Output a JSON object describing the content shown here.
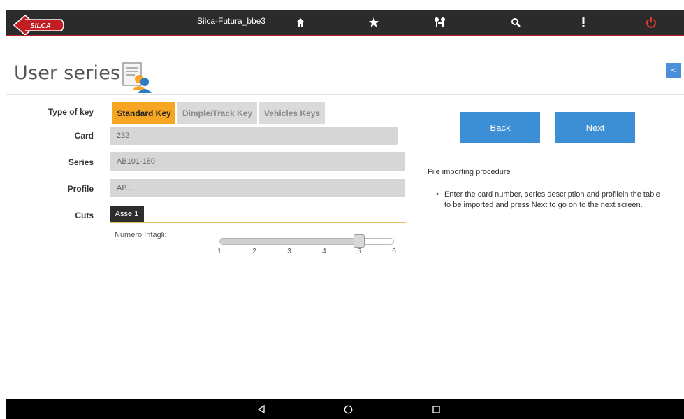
{
  "topbar": {
    "title": "Silca-Futura_bbe3",
    "logo_text": "SILCA",
    "icons": [
      "home-icon",
      "star-icon",
      "keys-icon",
      "search-icon",
      "info-icon",
      "power-icon"
    ],
    "accent_color": "#c31d24",
    "power_color": "#e23b2e"
  },
  "header": {
    "title": "User series",
    "title_icon": "user-document-icon",
    "collapse_label": "<"
  },
  "form": {
    "type_of_key_label": "Type of key",
    "tabs": [
      {
        "label": "Standard Key",
        "active": true
      },
      {
        "label": "Dimple/Track Key",
        "active": false
      },
      {
        "label": "Vehicles Keys",
        "active": false
      }
    ],
    "card_label": "Card",
    "card_value": "232",
    "series_label": "Series",
    "series_value": "AB101-180",
    "profile_label": "Profile",
    "profile_value": "AB...",
    "cuts_label": "Cuts",
    "cuts_tab": "Asse 1",
    "numero_label": "Numero Intagli:",
    "slider": {
      "ticks": [
        "1",
        "2",
        "3",
        "4",
        "5",
        "6"
      ],
      "value": 5
    }
  },
  "actions": {
    "back": "Back",
    "next": "Next",
    "button_color": "#3c8fd5",
    "active_tab_color": "#f6a623"
  },
  "procedure": {
    "title": "File importing procedure",
    "items": [
      "Enter the card number, series description and profilein the table to be imported and press Next to go on to the next screen."
    ]
  },
  "bottom_nav": {
    "icons": [
      "back-icon",
      "home-circle-icon",
      "recents-icon"
    ]
  }
}
